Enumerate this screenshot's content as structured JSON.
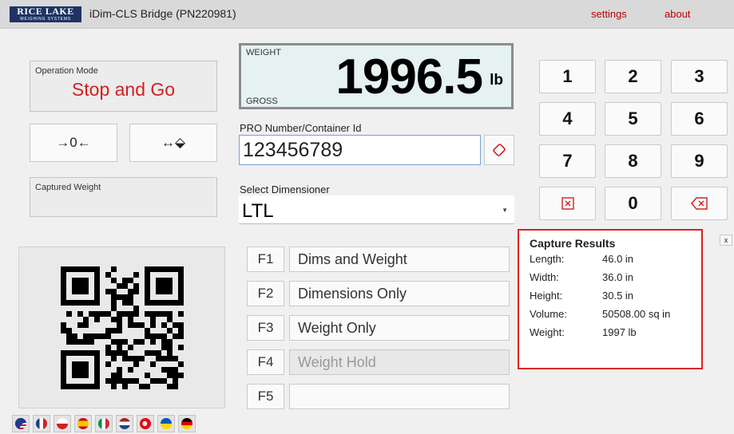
{
  "window": {
    "logo_line1": "RICE LAKE",
    "logo_line2": "WEIGHING SYSTEMS",
    "title": "iDim-CLS Bridge (PN220981)",
    "settings_link": "settings",
    "about_link": "about"
  },
  "operation_mode": {
    "label": "Operation Mode",
    "value": "Stop and Go"
  },
  "zero_button": {
    "icon": "zero-icon",
    "symbol": "→0←"
  },
  "tare_button": {
    "icon": "tare-icon",
    "symbol": "↔⬙"
  },
  "captured_weight": {
    "label": "Captured Weight",
    "value": ""
  },
  "weight_display": {
    "top_label": "WEIGHT",
    "bottom_label": "GROSS",
    "value": "1996.5",
    "unit": "lb"
  },
  "pro_number": {
    "label": "PRO Number/Container Id",
    "value": "123456789",
    "clear_icon": "eraser-icon"
  },
  "dimensioner": {
    "label": "Select Dimensioner",
    "value": "LTL"
  },
  "function_keys": [
    {
      "key": "F1",
      "label": "Dims and Weight",
      "enabled": true
    },
    {
      "key": "F2",
      "label": "Dimensions Only",
      "enabled": true
    },
    {
      "key": "F3",
      "label": "Weight Only",
      "enabled": true
    },
    {
      "key": "F4",
      "label": "Weight Hold",
      "enabled": false
    },
    {
      "key": "F5",
      "label": "",
      "enabled": true
    }
  ],
  "keypad": {
    "keys": [
      "1",
      "2",
      "3",
      "4",
      "5",
      "6",
      "7",
      "8",
      "9",
      "",
      "0",
      ""
    ],
    "clear_icon": "clear-x-icon",
    "backspace_icon": "backspace-icon"
  },
  "capture_results": {
    "title": "Capture Results",
    "rows": [
      {
        "label": "Length:",
        "value": "46.0 in"
      },
      {
        "label": "Width:",
        "value": "36.0 in"
      },
      {
        "label": "Height:",
        "value": "30.5 in"
      },
      {
        "label": "Volume:",
        "value": "50508.00 sq in"
      },
      {
        "label": "Weight:",
        "value": "1997 lb"
      }
    ],
    "close_label": "x"
  },
  "qr_code": {
    "icon": "qr-code-icon"
  },
  "languages": [
    "english",
    "french",
    "polish",
    "spanish",
    "italian",
    "dutch",
    "turkish",
    "ukrainian",
    "german"
  ],
  "colors": {
    "accent_red": "#d41f1f",
    "logo_navy": "#1e3364",
    "results_border": "#e02020",
    "weight_bg": "#e6f2f2"
  }
}
